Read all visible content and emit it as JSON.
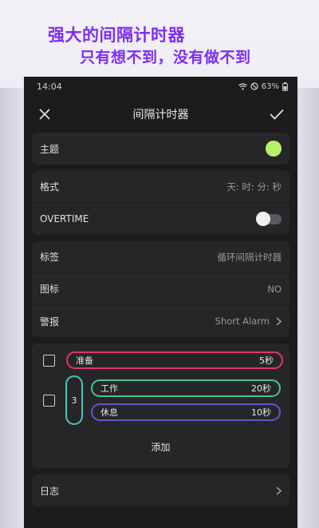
{
  "promo": {
    "line1": "强大的间隔计时器",
    "line2": "只有想不到，没有做不到",
    "color": "#7b2ff0"
  },
  "statusbar": {
    "time": "14:04",
    "battery": "63%"
  },
  "topbar": {
    "title": "间隔计时器",
    "close_icon": "close-icon",
    "confirm_icon": "check-icon"
  },
  "theme": {
    "label": "主题",
    "color": "#b8f06a"
  },
  "format": {
    "label": "格式",
    "value": "天: 时: 分: 秒"
  },
  "overtime": {
    "label": "OVERTIME",
    "on": false
  },
  "label_row": {
    "label": "标签",
    "value": "循环间隔计时器"
  },
  "icon_row": {
    "label": "图标",
    "value": "NO"
  },
  "alarm_row": {
    "label": "警报",
    "value": "Short Alarm"
  },
  "sequence": {
    "prepare": {
      "name": "准备",
      "duration": "5秒",
      "color": "#e0346f"
    },
    "loop_count": "3",
    "loop_color": "#43c6c0",
    "work": {
      "name": "工作",
      "duration": "20秒",
      "color": "#3fc98a"
    },
    "rest": {
      "name": "休息",
      "duration": "10秒",
      "color": "#5a5ad6"
    },
    "add_label": "添加"
  },
  "log_row": {
    "label": "日志"
  }
}
